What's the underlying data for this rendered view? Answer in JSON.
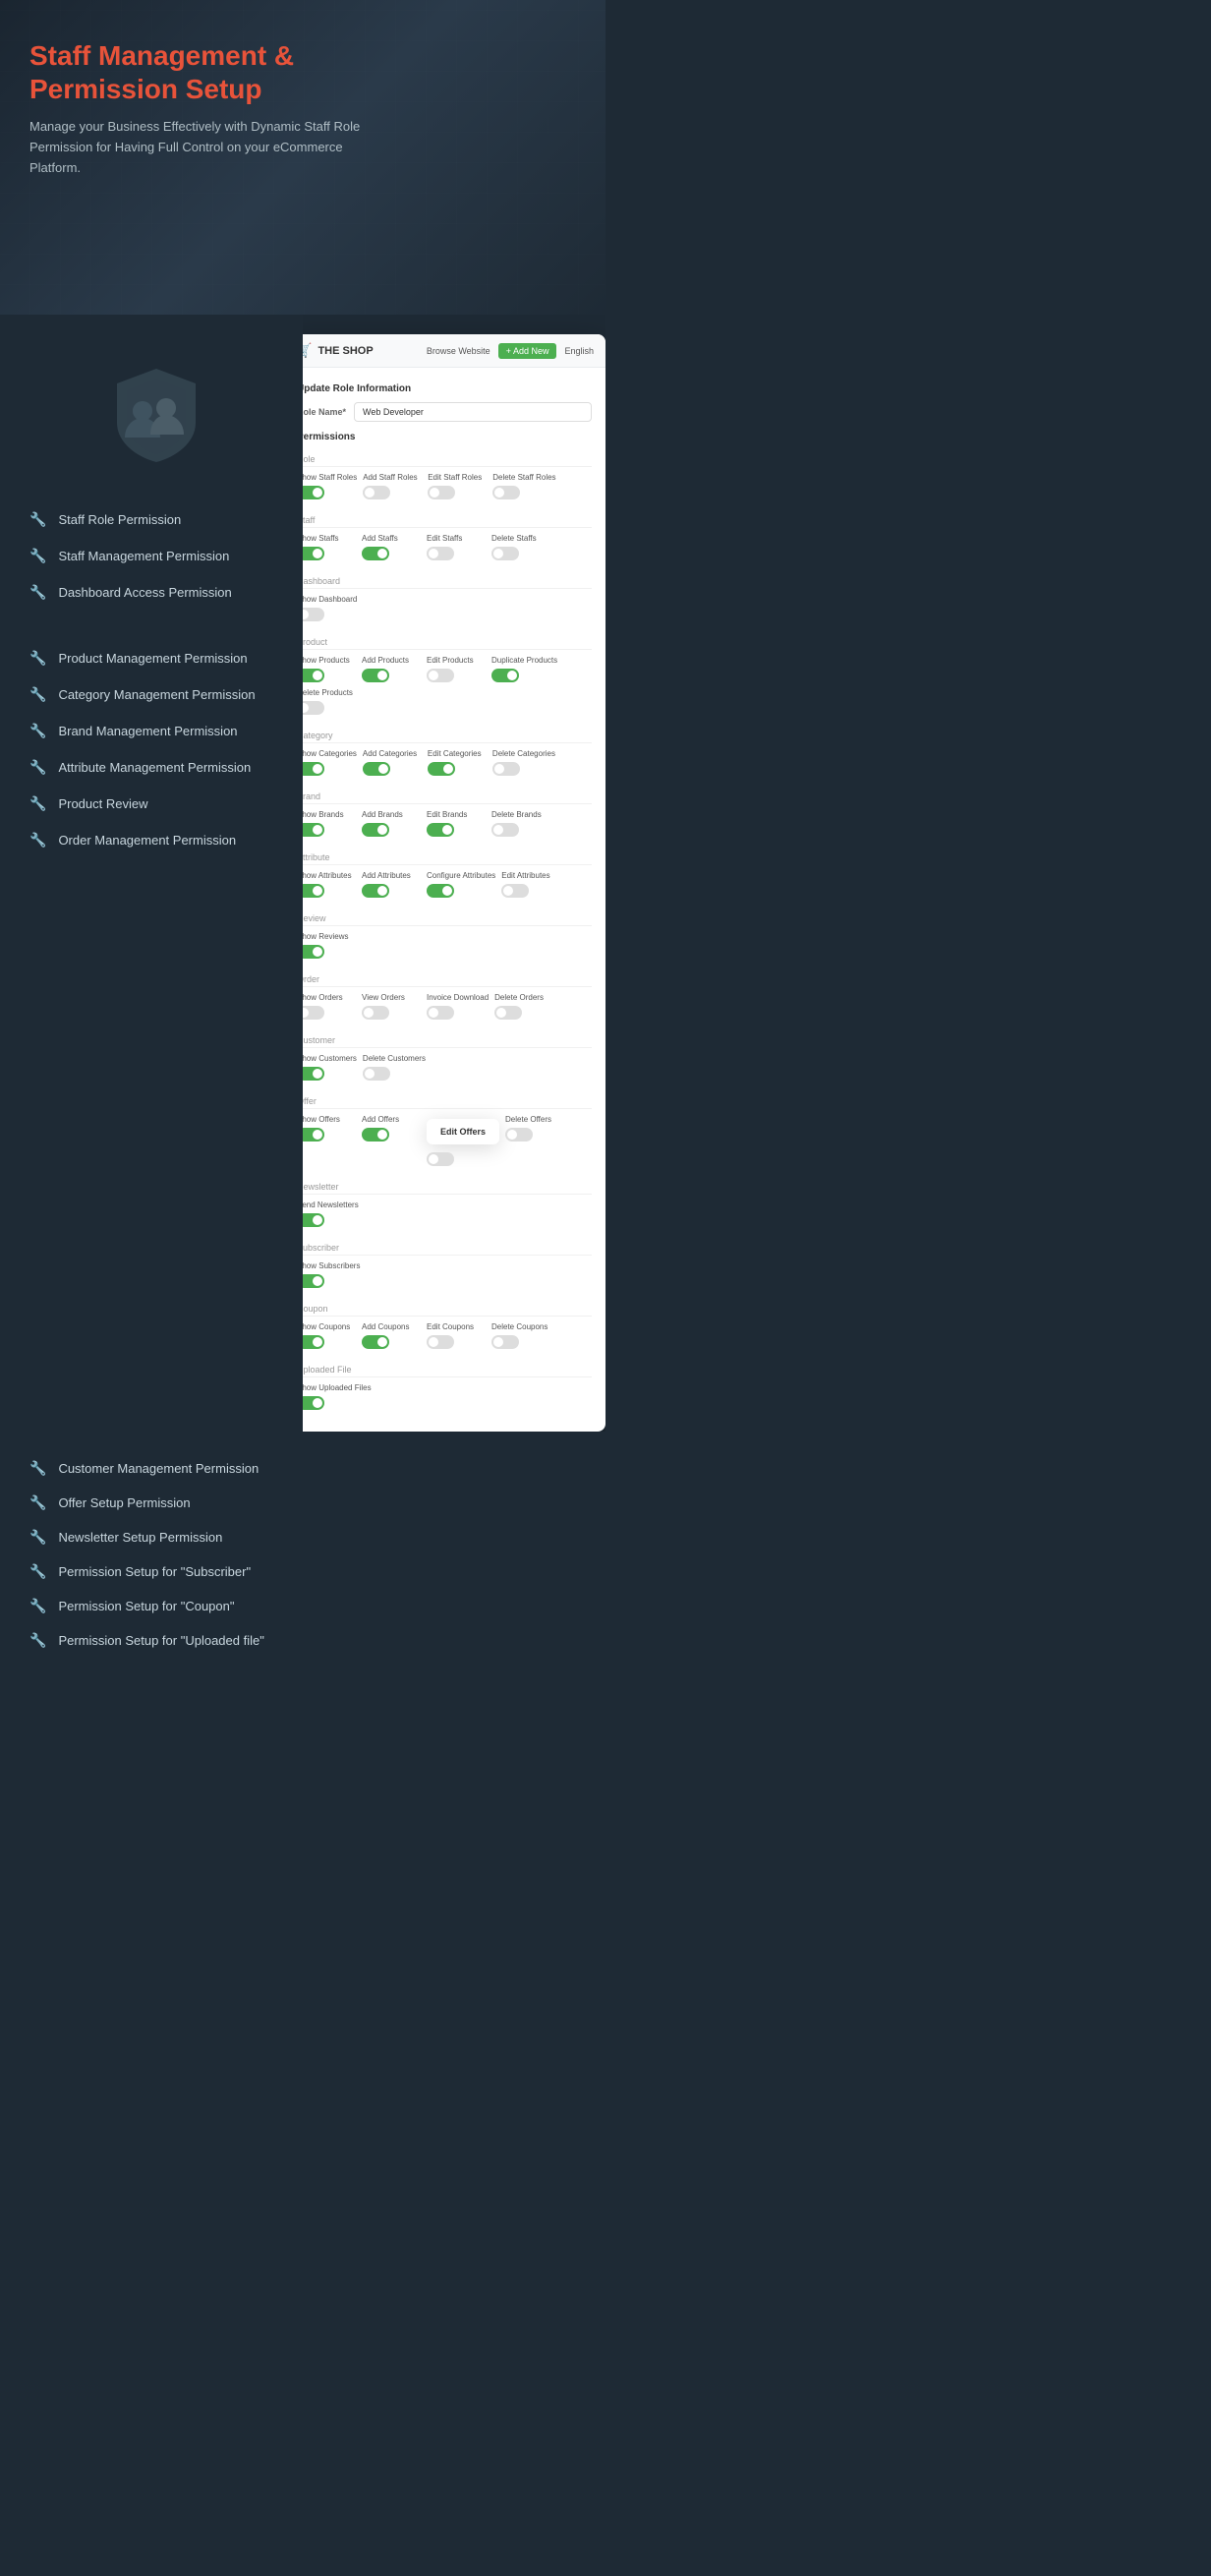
{
  "hero": {
    "title_line1": "Staff Management &",
    "title_line2": "Permission Setup",
    "description": "Manage your Business Effectively with Dynamic Staff Role Permission for Having Full Control on your eCommerce Platform."
  },
  "features_top": [
    "Staff Role Permission",
    "Staff Management Permission",
    "Dashboard Access Permission"
  ],
  "features_bottom": [
    "Product Management Permission",
    "Category Management Permission",
    "Brand Management Permission",
    "Attribute Management Permission",
    "Product Review",
    "Order Management Permission"
  ],
  "features_lower": [
    "Customer Management Permission",
    "Offer Setup Permission",
    "Newsletter Setup Permission",
    "Permission Setup for \"Subscriber\"",
    "Permission Setup for \"Coupon\"",
    "Permission Setup for \"Uploaded file\""
  ],
  "ui": {
    "logo": "THE SHOP",
    "nav": {
      "browse": "Browse Website",
      "add_new": "+ Add New",
      "lang": "English"
    },
    "role_form": {
      "title": "Update Role Information",
      "role_name_label": "Role Name*",
      "role_name_value": "Web Developer",
      "permissions_label": "Permissions"
    },
    "sections": {
      "role": {
        "label": "Role",
        "items": [
          {
            "label": "Show Staff Roles",
            "state": "on"
          },
          {
            "label": "Add Staff Roles",
            "state": "off"
          },
          {
            "label": "Edit Staff Roles",
            "state": "off"
          },
          {
            "label": "Delete Staff Roles",
            "state": "off"
          }
        ]
      },
      "staff": {
        "label": "Staff",
        "items": [
          {
            "label": "Show Staffs",
            "state": "on"
          },
          {
            "label": "Add Staffs",
            "state": "on"
          },
          {
            "label": "Edit Staffs",
            "state": "off"
          },
          {
            "label": "Delete Staffs",
            "state": "off"
          }
        ]
      },
      "dashboard": {
        "label": "Dashboard",
        "items": [
          {
            "label": "Show Dashboard",
            "state": "off"
          }
        ]
      },
      "product": {
        "label": "Product",
        "items": [
          {
            "label": "Show Products",
            "state": "on"
          },
          {
            "label": "Add Products",
            "state": "on"
          },
          {
            "label": "Edit Products",
            "state": "off"
          },
          {
            "label": "Duplicate Products",
            "state": "on"
          },
          {
            "label": "Delete Products",
            "state": "off"
          }
        ]
      },
      "category": {
        "label": "Category",
        "items": [
          {
            "label": "Show Categories",
            "state": "on"
          },
          {
            "label": "Add Categories",
            "state": "on"
          },
          {
            "label": "Edit Categories",
            "state": "on"
          },
          {
            "label": "Delete Categories",
            "state": "off"
          }
        ]
      },
      "brand": {
        "label": "Brand",
        "items": [
          {
            "label": "Show Brands",
            "state": "on"
          },
          {
            "label": "Add Brands",
            "state": "on"
          },
          {
            "label": "Edit Brands",
            "state": "on"
          },
          {
            "label": "Delete Brands",
            "state": "off"
          }
        ]
      },
      "attribute": {
        "label": "Attribute",
        "items": [
          {
            "label": "Show Attributes",
            "state": "on"
          },
          {
            "label": "Add Attributes",
            "state": "on"
          },
          {
            "label": "Configure Attributes",
            "state": "on"
          },
          {
            "label": "Edit Attributes",
            "state": "off"
          }
        ]
      },
      "review": {
        "label": "Review",
        "items": [
          {
            "label": "Show Reviews",
            "state": "on"
          }
        ]
      },
      "order": {
        "label": "Order",
        "items": [
          {
            "label": "Show Orders",
            "state": "off"
          },
          {
            "label": "View Orders",
            "state": "off"
          },
          {
            "label": "Invoice Download",
            "state": "off"
          },
          {
            "label": "Delete Orders",
            "state": "off"
          }
        ]
      },
      "customer": {
        "label": "Customer",
        "items": [
          {
            "label": "Show Customers",
            "state": "on"
          },
          {
            "label": "Delete Customers",
            "state": "off"
          }
        ]
      },
      "offer": {
        "label": "Offer",
        "items": [
          {
            "label": "Show Offers",
            "state": "on"
          },
          {
            "label": "Add Offers",
            "state": "on"
          },
          {
            "label": "Edit Offers",
            "state": "off"
          },
          {
            "label": "Delete Offers",
            "state": "off"
          }
        ]
      },
      "newsletter": {
        "label": "Newsletter",
        "items": [
          {
            "label": "Send Newsletters",
            "state": "on"
          }
        ]
      },
      "subscriber": {
        "label": "Subscriber",
        "items": [
          {
            "label": "Show Subscribers",
            "state": "on"
          }
        ]
      },
      "coupon": {
        "label": "Coupon",
        "items": [
          {
            "label": "Show Coupons",
            "state": "on"
          },
          {
            "label": "Add Coupons",
            "state": "on"
          },
          {
            "label": "Edit Coupons",
            "state": "off"
          },
          {
            "label": "Delete Coupons",
            "state": "off"
          }
        ]
      },
      "uploaded_file": {
        "label": "Uploaded File",
        "items": [
          {
            "label": "Show Uploaded Files",
            "state": "on"
          }
        ]
      }
    }
  },
  "tooltip": {
    "edit_offers": "Edit Offers"
  }
}
